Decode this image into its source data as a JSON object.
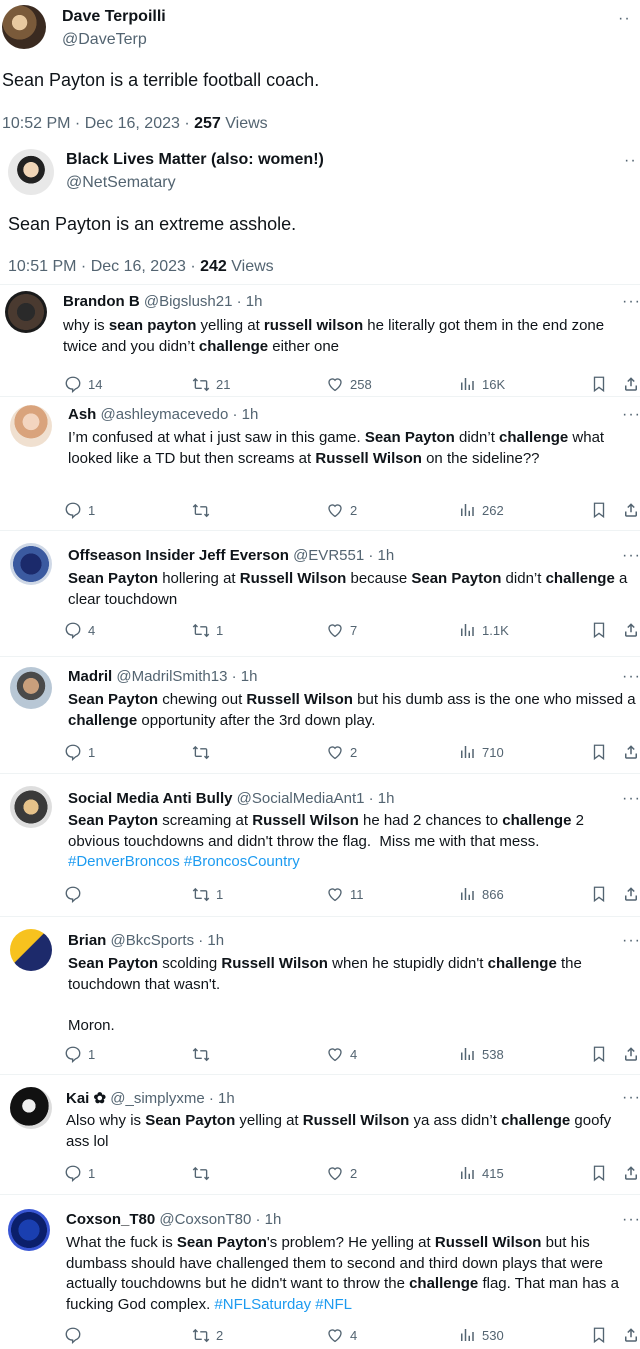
{
  "main_tweets": [
    {
      "name": "Dave Terpoilli",
      "handle": "@DaveTerp",
      "text": "Sean Payton is a terrible football coach.",
      "time": "10:52 PM · Dec 16, 2023 ·",
      "views": "257",
      "views_label": "Views"
    },
    {
      "name": "Black Lives Matter (also: women!)",
      "handle": "@NetSematary",
      "text": "Sean Payton is an extreme asshole.",
      "time": "10:51 PM · Dec 16, 2023 ·",
      "views": "242",
      "views_label": "Views"
    }
  ],
  "replies": [
    {
      "name": "Brandon B",
      "handle": "@Bigslush21 · 1h",
      "body": [
        [
          "why is ",
          0
        ],
        [
          "sean payton",
          1
        ],
        [
          " yelling at ",
          0
        ],
        [
          "russell wilson",
          1
        ],
        [
          " he literally got them in the end zone twice and you didn’t ",
          0
        ],
        [
          "challenge",
          1
        ],
        [
          " either one",
          0
        ]
      ],
      "replies": "14",
      "retweets": "21",
      "likes": "258",
      "views": "16K"
    },
    {
      "name": "Ash",
      "handle": "@ashleymacevedo · 1h",
      "body": [
        [
          "I’m confused at what i just saw in this game. ",
          0
        ],
        [
          "Sean Payton",
          1
        ],
        [
          " didn’t ",
          0
        ],
        [
          "challenge",
          1
        ],
        [
          " what looked like a TD but then screams at ",
          0
        ],
        [
          "Russell Wilson",
          1
        ],
        [
          " on the sideline??",
          0
        ]
      ],
      "replies": "1",
      "retweets": "",
      "likes": "2",
      "views": "262"
    },
    {
      "name": "Offseason Insider Jeff Everson",
      "handle": "@EVR551 · 1h",
      "body": [
        [
          "Sean Payton",
          1
        ],
        [
          " hollering at ",
          0
        ],
        [
          "Russell Wilson",
          1
        ],
        [
          " because ",
          0
        ],
        [
          "Sean Payton",
          1
        ],
        [
          " didn’t ",
          0
        ],
        [
          "challenge",
          1
        ],
        [
          " a clear touchdown",
          0
        ]
      ],
      "replies": "4",
      "retweets": "1",
      "likes": "7",
      "views": "1.1K"
    },
    {
      "name": "Madril",
      "handle": "@MadrilSmith13 · 1h",
      "body": [
        [
          "Sean Payton",
          1
        ],
        [
          " chewing out ",
          0
        ],
        [
          "Russell Wilson",
          1
        ],
        [
          " but his dumb ass is the one who missed a ",
          0
        ],
        [
          "challenge",
          1
        ],
        [
          " opportunity after the 3rd down play.",
          0
        ]
      ],
      "replies": "1",
      "retweets": "",
      "likes": "2",
      "views": "710"
    },
    {
      "name": "Social Media Anti Bully",
      "handle": "@SocialMediaAnt1 · 1h",
      "body": [
        [
          "Sean Payton",
          1
        ],
        [
          " screaming at ",
          0
        ],
        [
          "Russell Wilson",
          1
        ],
        [
          " he had 2 chances to ",
          0
        ],
        [
          "challenge",
          1
        ],
        [
          " 2 obvious touchdowns and didn't throw the flag.  Miss me with that mess. ",
          0
        ],
        [
          "#DenverBroncos #BroncosCountry",
          2
        ]
      ],
      "replies": "",
      "retweets": "1",
      "likes": "11",
      "views": "866"
    },
    {
      "name": "Brian",
      "handle": "@BkcSports · 1h",
      "body": [
        [
          "Sean Payton",
          1
        ],
        [
          " scolding ",
          0
        ],
        [
          "Russell Wilson",
          1
        ],
        [
          " when he stupidly didn't ",
          0
        ],
        [
          "challenge",
          1
        ],
        [
          " the touchdown that wasn't.\n\nMoron.",
          0
        ]
      ],
      "replies": "1",
      "retweets": "",
      "likes": "4",
      "views": "538"
    },
    {
      "name": "Kai ✿",
      "handle": "@_simplyxme · 1h",
      "body": [
        [
          "Also why is ",
          0
        ],
        [
          "Sean Payton",
          1
        ],
        [
          " yelling at ",
          0
        ],
        [
          "Russell Wilson",
          1
        ],
        [
          " ya ass didn’t ",
          0
        ],
        [
          "challenge",
          1
        ],
        [
          " goofy ass lol",
          0
        ]
      ],
      "replies": "1",
      "retweets": "",
      "likes": "2",
      "views": "415"
    },
    {
      "name": "Coxson_T80",
      "handle": "@CoxsonT80 · 1h",
      "body": [
        [
          "What the fuck is ",
          0
        ],
        [
          "Sean Payton",
          1
        ],
        [
          "'s problem? He yelling at ",
          0
        ],
        [
          "Russell Wilson",
          1
        ],
        [
          " but his dumbass should have challenged them to second and third down plays that were actually touchdowns but he didn't want to throw the ",
          0
        ],
        [
          "challenge",
          1
        ],
        [
          " flag. That man has a fucking God complex. ",
          0
        ],
        [
          "#NFLSaturday #NFL",
          2
        ]
      ],
      "replies": "",
      "retweets": "2",
      "likes": "4",
      "views": "530"
    }
  ],
  "colors": {
    "text": "#0f1419",
    "muted": "#536471",
    "link": "#1d9bf0"
  }
}
